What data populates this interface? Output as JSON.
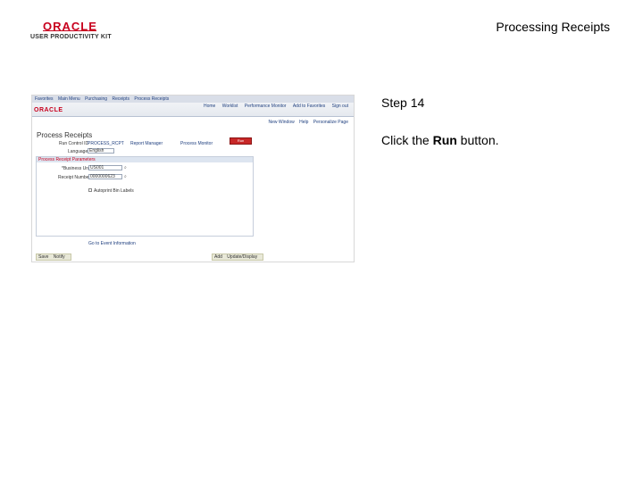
{
  "header": {
    "logo_oracle": "ORACLE",
    "logo_sub": "USER PRODUCTIVITY KIT",
    "title": "Processing Receipts"
  },
  "instruction": {
    "step": "Step 14",
    "text_before": "Click the ",
    "text_bold": "Run",
    "text_after": " button."
  },
  "screenshot": {
    "crumbs": [
      "Favorites",
      "Main Menu",
      "Purchasing",
      "Receipts",
      "Process Receipts"
    ],
    "brand": "ORACLE",
    "nav_links": [
      "Home",
      "Worklist",
      "Performance Monitor",
      "Add to Favorites",
      "Sign out"
    ],
    "subnav": [
      "New Window",
      "Help",
      "Personalize Page"
    ],
    "page_title": "Process Receipts",
    "run_control_label": "Run Control ID",
    "run_control_value": "PROCESS_RCPT",
    "report_manager": "Report Manager",
    "process_monitor": "Process Monitor",
    "run_button": "Run",
    "language_label": "Language",
    "language_value": "English",
    "section_title": "Process Receipt Parameters",
    "business_unit_label": "*Business Unit",
    "business_unit_value": "US001",
    "receipt_number_label": "Receipt Number",
    "receipt_number_value": "0000000623",
    "checkbox_label": "Autoprint Bin Labels",
    "footer_link": "Go to Event Information",
    "bottom_left_buttons": [
      "Save",
      "Notify"
    ],
    "bottom_right_buttons": [
      "Add",
      "Update/Display"
    ]
  }
}
